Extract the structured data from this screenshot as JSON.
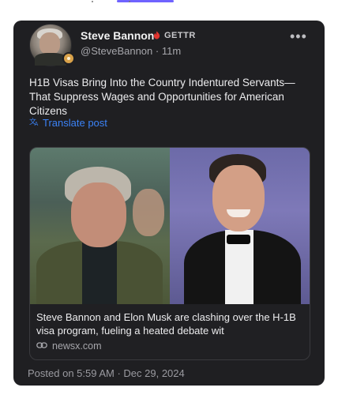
{
  "author": {
    "name": "Steve Bannon",
    "platform": "GETTR",
    "handle": "@SteveBannon",
    "time": "11m"
  },
  "menu": {
    "more_label": "•••"
  },
  "post": {
    "text": "H1B Visas Bring Into the Country Indentured Servants—That Suppress Wages and Opportunities for American Citizens",
    "translate_label": "Translate post"
  },
  "link_card": {
    "title": "Steve Bannon and Elon Musk are clashing over the H-1B visa program, fueling a heated debate wit",
    "domain": "newsx.com"
  },
  "footer": {
    "posted": "Posted on 5:59 AM · Dec 29, 2024"
  },
  "colors": {
    "card_bg": "#1f1f22",
    "link_blue": "#3b82f6",
    "verified_red": "#e0342f"
  },
  "icons": {
    "avatar": "user-avatar",
    "badge": "rank-badge-icon",
    "verified": "verified-flame-icon",
    "translate": "translate-icon",
    "link": "link-icon",
    "more": "more-horizontal-icon"
  }
}
